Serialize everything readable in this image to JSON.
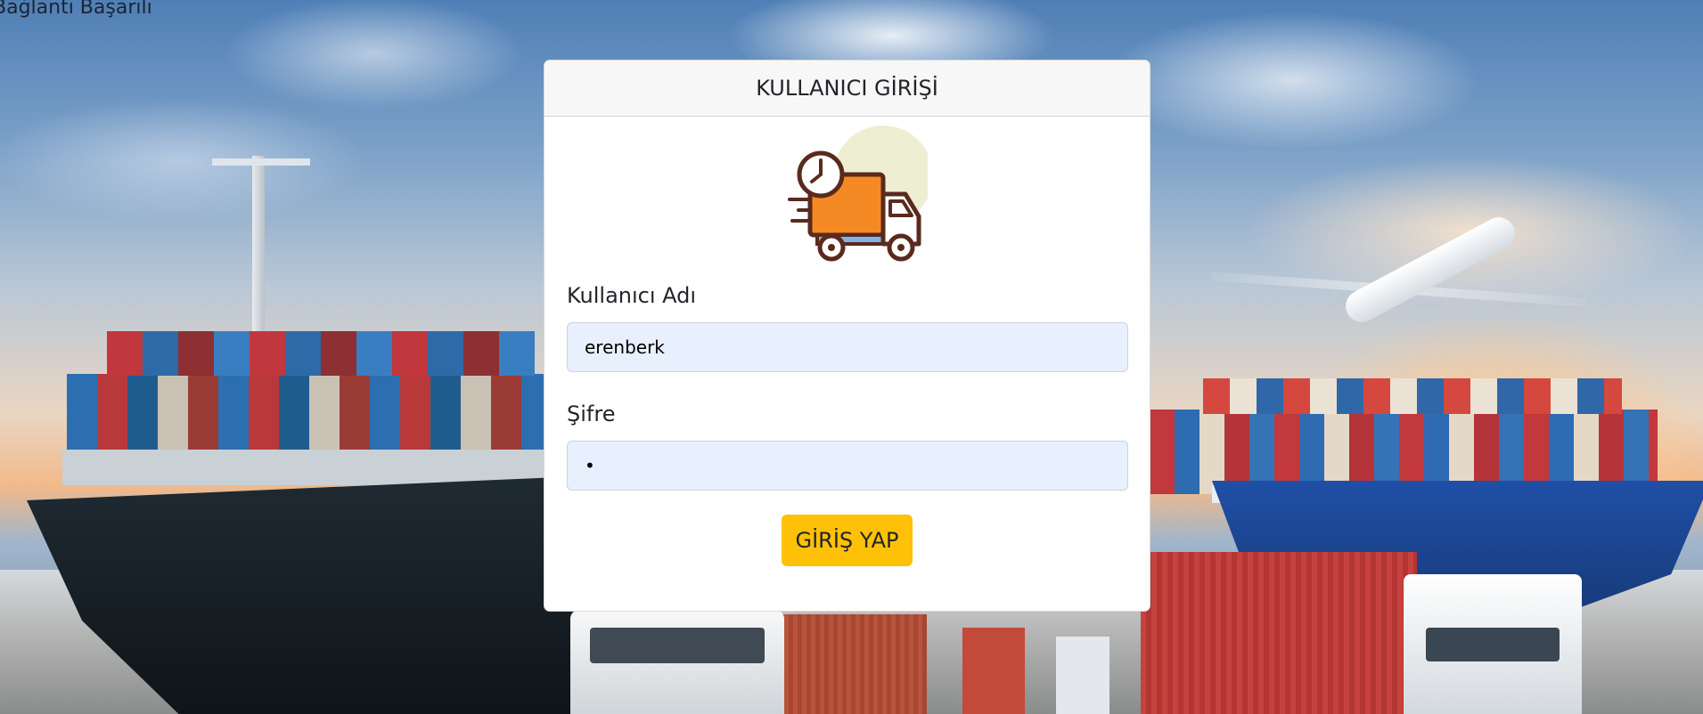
{
  "status": {
    "text": "Bağlantı Başarılı"
  },
  "login": {
    "title": "KULLANICI GİRİŞİ",
    "logo_icon": "delivery-truck-icon",
    "username_label": "Kullanıcı Adı",
    "username_value": "erenberk",
    "password_label": "Şifre",
    "password_value": "1",
    "submit_label": "GİRİŞ YAP"
  },
  "colors": {
    "button": "#ffc107",
    "input_bg": "#e8f0fe",
    "header_bg": "#f7f7f7",
    "truck_orange": "#f58a25",
    "truck_outline": "#5a2a1e"
  }
}
